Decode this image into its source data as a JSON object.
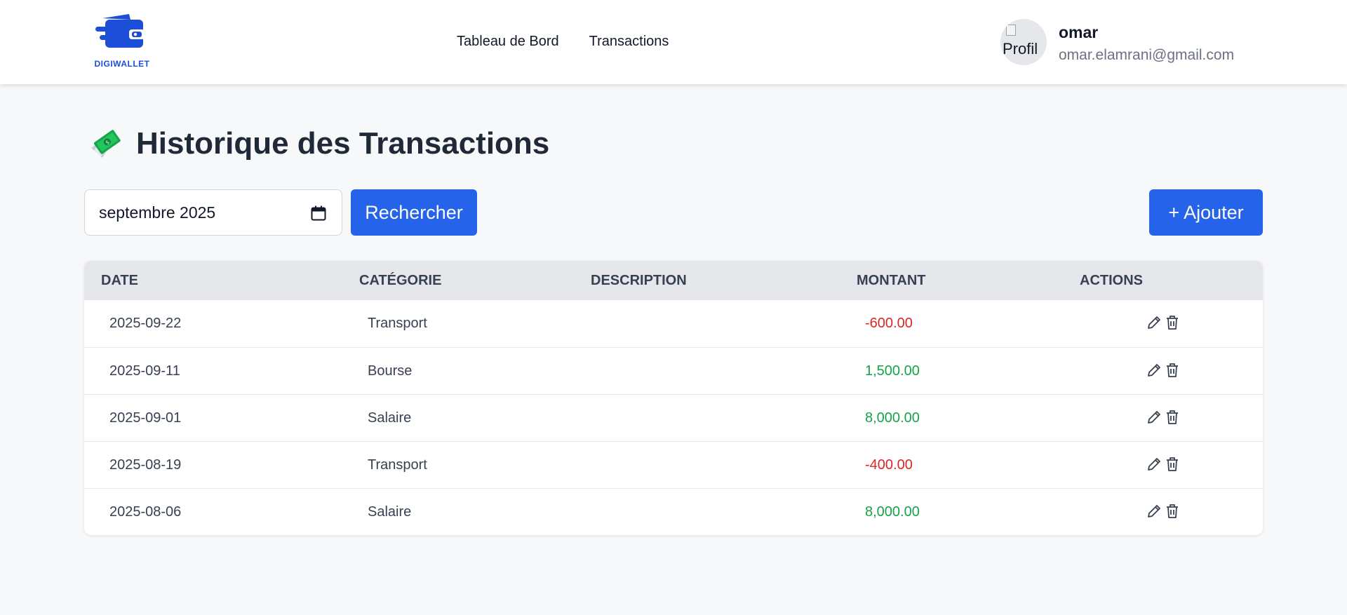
{
  "header": {
    "logo_text": "DIGIWALLET",
    "nav": [
      {
        "label": "Tableau de Bord"
      },
      {
        "label": "Transactions"
      }
    ],
    "user": {
      "avatar_alt": "Profil",
      "name": "omar",
      "email": "omar.elamrani@gmail.com"
    }
  },
  "page": {
    "title": "Historique des Transactions",
    "title_icon": "money-with-wings-icon"
  },
  "toolbar": {
    "month_value": "septembre 2025",
    "search_label": "Rechercher",
    "add_label": "+ Ajouter"
  },
  "table": {
    "columns": [
      "Date",
      "Catégorie",
      "Description",
      "Montant",
      "Actions"
    ],
    "rows": [
      {
        "date": "2025-09-22",
        "category": "Transport",
        "description": "",
        "amount": "-600.00",
        "sign": "neg"
      },
      {
        "date": "2025-09-11",
        "category": "Bourse",
        "description": "",
        "amount": "1,500.00",
        "sign": "pos"
      },
      {
        "date": "2025-09-01",
        "category": "Salaire",
        "description": "",
        "amount": "8,000.00",
        "sign": "pos"
      },
      {
        "date": "2025-08-19",
        "category": "Transport",
        "description": "",
        "amount": "-400.00",
        "sign": "neg"
      },
      {
        "date": "2025-08-06",
        "category": "Salaire",
        "description": "",
        "amount": "8,000.00",
        "sign": "pos"
      }
    ]
  },
  "colors": {
    "primary": "#2563eb",
    "negative": "#dc2626",
    "positive": "#16a34a",
    "table_header_bg": "#e5e7eb"
  }
}
